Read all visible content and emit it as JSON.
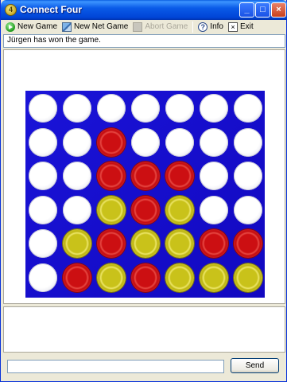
{
  "window": {
    "title": "Connect Four",
    "icon_letter": "4"
  },
  "toolbar": {
    "new_game": "New Game",
    "new_net_game": "New Net Game",
    "abort_game": "Abort Game",
    "info": "Info",
    "exit": "Exit"
  },
  "status": "Jürgen has won the game.",
  "board": {
    "columns": 7,
    "rows": 6,
    "cells": [
      [
        "empty",
        "empty",
        "empty",
        "empty",
        "empty",
        "empty",
        "empty"
      ],
      [
        "empty",
        "empty",
        "red",
        "empty",
        "empty",
        "empty",
        "empty"
      ],
      [
        "empty",
        "empty",
        "red",
        "red",
        "red",
        "empty",
        "empty"
      ],
      [
        "empty",
        "empty",
        "yellow",
        "red",
        "yellow",
        "empty",
        "empty"
      ],
      [
        "empty",
        "yellow",
        "red",
        "yellow",
        "yellow",
        "red",
        "red"
      ],
      [
        "empty",
        "red",
        "yellow",
        "red",
        "yellow",
        "yellow",
        "yellow"
      ]
    ],
    "colors": {
      "board": "#1a12d4",
      "red": "#cc0f12",
      "yellow": "#c9c21a"
    }
  },
  "chat": {
    "input_value": "",
    "send_label": "Send"
  }
}
